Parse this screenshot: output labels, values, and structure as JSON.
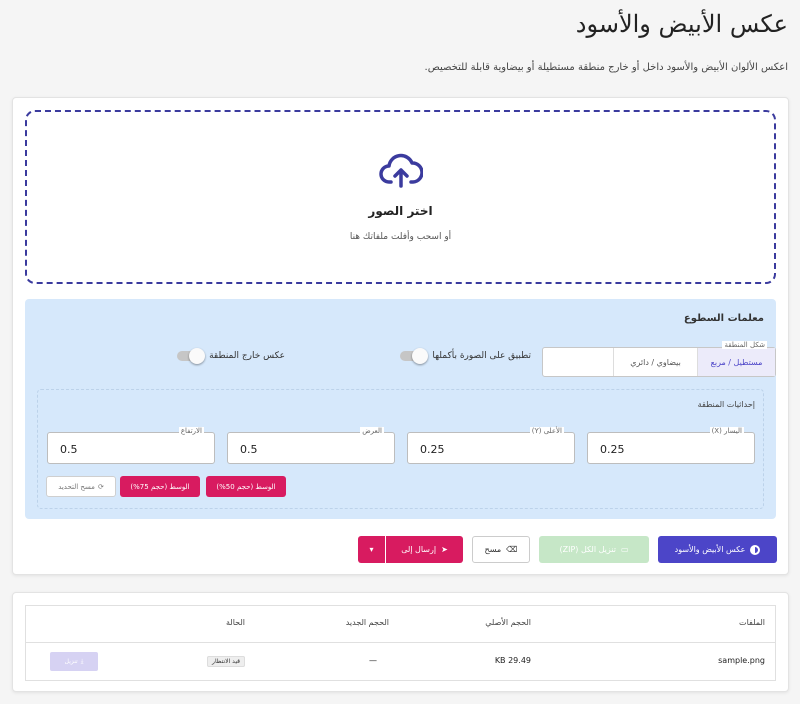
{
  "page": {
    "title": "عكس الأبيض والأسود",
    "description": "اعكس الألوان الأبيض والأسود داخل أو خارج منطقة مستطيلة أو بيضاوية قابلة للتخصيص."
  },
  "upload": {
    "icon": "cloud-upload-icon",
    "title": "اختر الصور",
    "subtitle": "أو اسحب وأفلت ملفاتك هنا"
  },
  "params": {
    "title": "معلمات السطوع",
    "shape": {
      "legend": "شكل المنطقة",
      "options": [
        "مستطيل / مربع",
        "بيضاوي / دائري"
      ],
      "selected": "مستطيل / مربع"
    },
    "toggles": [
      {
        "label": "تطبيق على الصورة بأكملها",
        "value": false
      },
      {
        "label": "عكس خارج المنطقة",
        "value": false
      }
    ],
    "coords": {
      "title": "إحداثيات المنطقة",
      "fields": [
        {
          "label": "اليسار (X)",
          "value": "0.25"
        },
        {
          "label": "الأعلى (Y)",
          "value": "0.25"
        },
        {
          "label": "العرض",
          "value": "0.5"
        },
        {
          "label": "الارتفاع",
          "value": "0.5"
        }
      ],
      "presets": [
        "الوسط (حجم 50%)",
        "الوسط (حجم 75%)"
      ],
      "reset_label": "مسح التحديد"
    }
  },
  "actions": {
    "invert": "عكس الأبيض والأسود",
    "download_zip": "تنزيل الكل (ZIP)",
    "clear": "مسح",
    "send_to": "إرسال إلى"
  },
  "files": {
    "headers": [
      "الملفات",
      "الحجم الأصلي",
      "الحجم الجديد",
      "الحالة"
    ],
    "rows": [
      {
        "name": "sample.png",
        "original_size": "29.49 KB",
        "new_size": "—",
        "status": "قيد الانتظار",
        "download": "تنزيل"
      }
    ]
  },
  "colors": {
    "primary": "#4c45c8",
    "accent": "#d81b60",
    "panel": "#d6e8fb",
    "zip_disabled": "#c6e7c7"
  }
}
